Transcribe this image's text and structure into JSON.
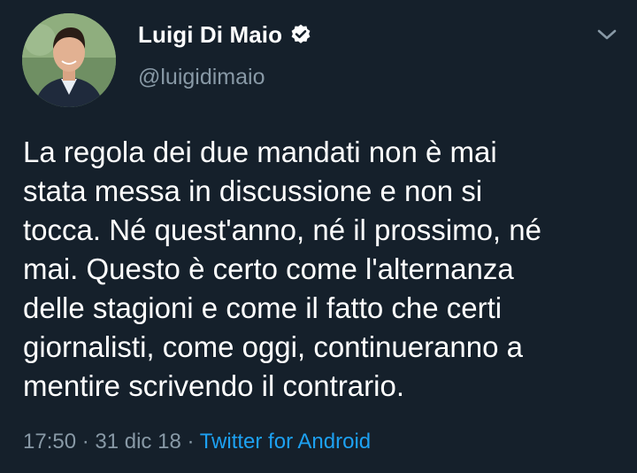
{
  "tweet": {
    "author": {
      "display_name": "Luigi Di Maio",
      "handle": "@luigidimaio",
      "verified_icon": "verified-badge-icon",
      "avatar_icon": "profile-photo"
    },
    "menu_icon": "chevron-down-icon",
    "text": "La regola dei due mandati non è mai\nstata messa in discussione e non si\ntocca. Né quest'anno, né il prossimo, né\nmai. Questo è certo come l'alternanza\ndelle stagioni e come il fatto che certi\ngiornalisti, come oggi, continueranno a\nmentire scrivendo il contrario.",
    "meta": {
      "time": "17:50",
      "separator": " · ",
      "date": "31 dic 18",
      "source": "Twitter for Android"
    }
  },
  "colors": {
    "background": "#15202b",
    "primary_text": "#ffffff",
    "secondary_text": "#8899a6",
    "link": "#1da1f2"
  }
}
